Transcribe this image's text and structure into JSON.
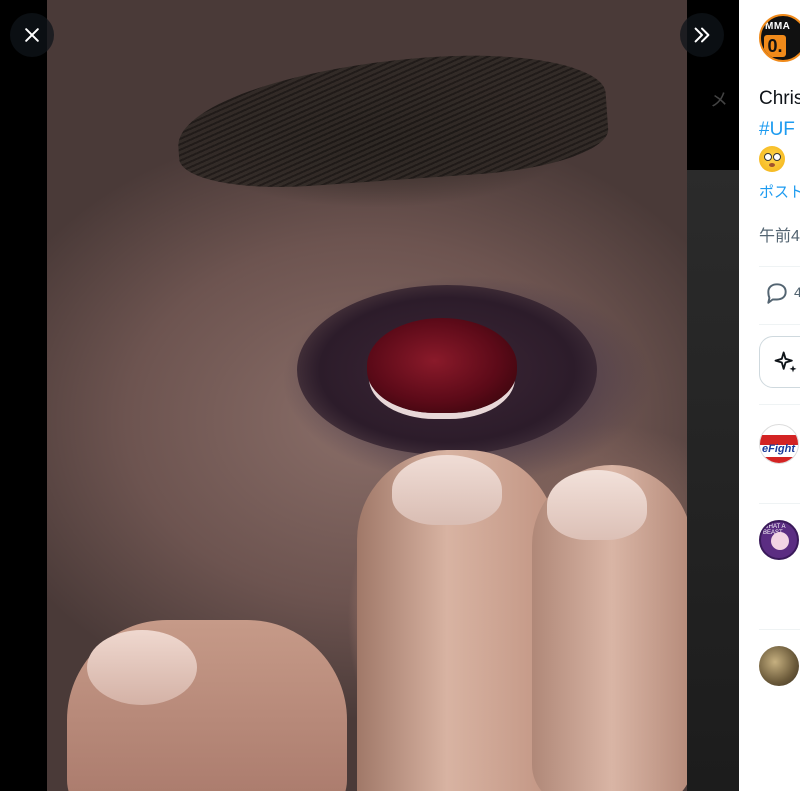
{
  "viewer": {
    "close_label": "Close",
    "expand_label": "Hide replies",
    "ghost_text": "メ"
  },
  "post": {
    "author_avatar": {
      "line1": "MMA",
      "line2": "0."
    },
    "text": "Chris",
    "hashtag": "#UF",
    "emoji": "flushed-face",
    "translate_link": "ポスト",
    "timestamp": "午前4",
    "reply_count": "4"
  },
  "replies": [
    {
      "avatar": "efight",
      "label_top": "格闘技情報サイト",
      "label_brand": "eFight",
      "label_bottom": "イーファイト"
    },
    {
      "avatar": "what-a-beast",
      "label_top": "WHAT A BEAST"
    },
    {
      "avatar": "photo"
    }
  ],
  "colors": {
    "accent": "#1d9bf0",
    "text": "#0f1419",
    "muted": "#536471",
    "brand_orange": "#f08a1a"
  }
}
